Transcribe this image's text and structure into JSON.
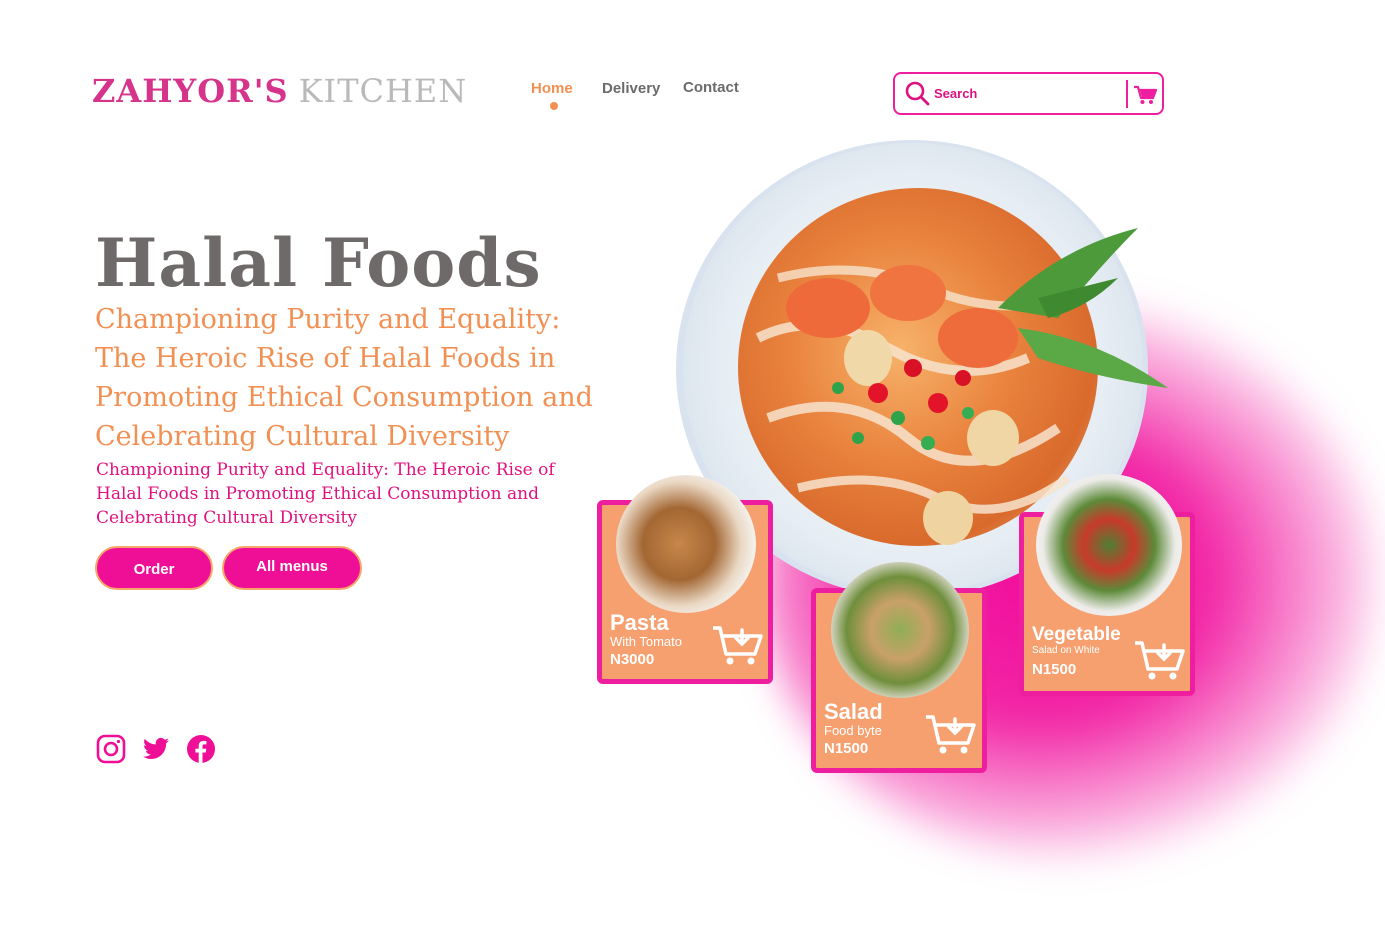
{
  "header": {
    "logo_part1": "ZAHYOR'S",
    "logo_part2": "KITCHEN",
    "nav": {
      "home": "Home",
      "delivery": "Delivery",
      "contact": "Contact"
    },
    "search_placeholder": "Search",
    "search_icon": "search-icon",
    "cart_icon": "cart-icon"
  },
  "hero": {
    "title": "Halal Foods",
    "subtitle": "Championing Purity and Equality: The Heroic Rise of Halal Foods in Promoting Ethical Consumption and Celebrating Cultural Diversity",
    "subtext": "Championing Purity and Equality: The Heroic Rise of Halal Foods in Promoting Ethical Consumption and Celebrating Cultural Diversity",
    "order_label": "Order",
    "menus_label": "All menus"
  },
  "social": [
    "instagram-icon",
    "twitter-icon",
    "facebook-icon"
  ],
  "cards": [
    {
      "name": "Pasta",
      "sub": "With Tomato",
      "price": "N3000"
    },
    {
      "name": "Salad",
      "sub": "Food byte",
      "price": "N1500"
    },
    {
      "name": "Vegetable",
      "sub": "Salad on White",
      "price": "N1500"
    }
  ],
  "colors": {
    "primary_pink": "#ee0f96",
    "accent_orange": "#f29054",
    "card_orange": "#f6a070",
    "text_gray": "#6b6b6b"
  }
}
